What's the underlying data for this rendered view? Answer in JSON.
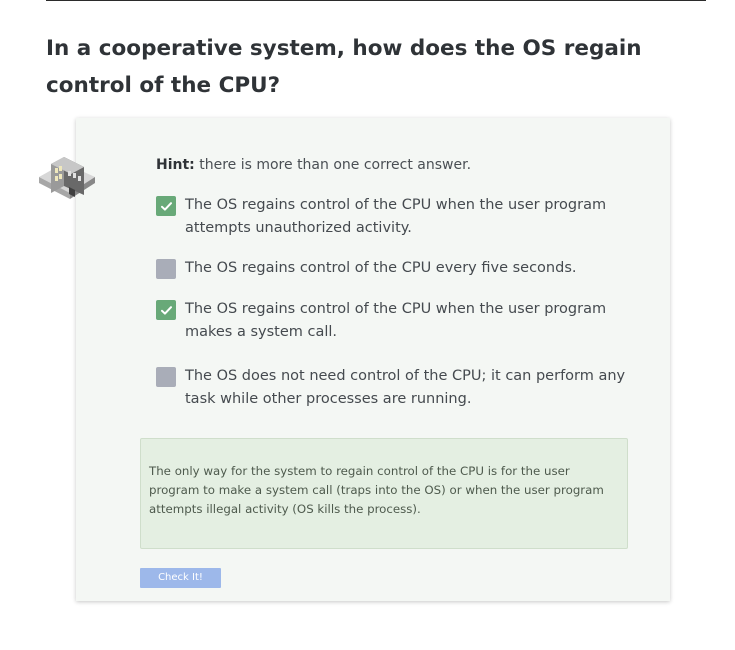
{
  "question": {
    "title": "In a cooperative system, how does the OS regain control of the CPU?"
  },
  "hint": {
    "label": "Hint:",
    "text": "there is more than one correct answer."
  },
  "options": [
    {
      "text": "The OS regains control of the CPU when the user program attempts unauthorized activity.",
      "checked": true
    },
    {
      "text": "The OS regains control of the CPU every five seconds.",
      "checked": false
    },
    {
      "text": "The OS regains control of the CPU when the user program makes a system call.",
      "checked": true
    },
    {
      "text": "The OS does not need control of the CPU; it can perform any task while other processes are running.",
      "checked": false
    }
  ],
  "feedback": {
    "text": "The only way for the system to regain control of the CPU is for the user program to make a system call (traps into the OS) or when the user program attempts illegal activity (OS kills the process)."
  },
  "check_button": {
    "label": "Check It!"
  },
  "icons": {
    "illustration": "isometric-building-icon",
    "checkmark": "checkmark-icon"
  },
  "colors": {
    "checked_box": "#68a978",
    "unchecked_box": "#a9adb8",
    "feedback_background": "#e4efe2",
    "button": "#9db8ea",
    "card_background": "#f4f7f4"
  }
}
